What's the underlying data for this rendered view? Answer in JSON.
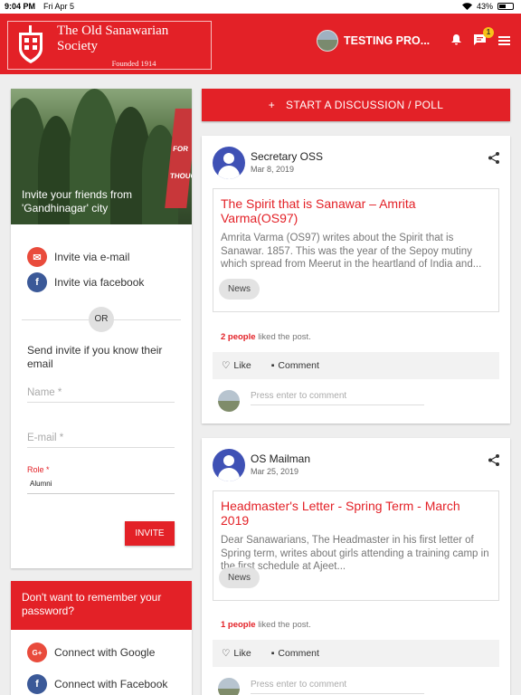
{
  "status_bar": {
    "time": "9:04 PM",
    "date": "Fri Apr 5",
    "battery": "43%"
  },
  "header": {
    "title": "The Old Sanawarian Society",
    "subtitle": "Founded 1914",
    "user_name": "TESTING PRO...",
    "chat_badge": "1",
    "icons": [
      "bell-icon",
      "chat-icon",
      "menu-icon"
    ]
  },
  "invite": {
    "hero_text": "Invite your friends from 'Gandhinagar' city",
    "via_email": "Invite via e-mail",
    "via_facebook": "Invite via facebook",
    "or": "OR",
    "send_text": "Send invite if you know their email",
    "name_placeholder": "Name *",
    "email_placeholder": "E-mail *",
    "role_label": "Role *",
    "role_value": "Alumni",
    "button": "INVITE"
  },
  "password_card": {
    "heading": "Don't want to remember your password?",
    "google": "Connect with Google",
    "facebook": "Connect with Facebook"
  },
  "start_discussion": {
    "label": "START A DISCUSSION / POLL"
  },
  "posts": [
    {
      "author": "Secretary OSS",
      "date": "Mar 8, 2019",
      "title": "The Spirit that is Sanawar – Amrita Varma(OS97)",
      "excerpt": "Amrita Varma (OS97) writes about the Spirit that is Sanawar. 1857. This was the year of the Sepoy mutiny which spread from Meerut in the heartland of India and...",
      "tag": "News",
      "likes_count": "2 people",
      "likes_text": "liked the post.",
      "like_label": "Like",
      "comment_label": "Comment",
      "comment_placeholder": "Press enter to comment"
    },
    {
      "author": "OS Mailman",
      "date": "Mar 25, 2019",
      "title": "Headmaster's Letter - Spring Term - March 2019",
      "excerpt": "Dear Sanawarians,   The Headmaster in his first letter of Spring term, writes about girls attending a training camp  in the first schedule at Ajeet...",
      "tag": "News",
      "likes_count": "1 people",
      "likes_text": "liked the post.",
      "like_label": "Like",
      "comment_label": "Comment",
      "comment_placeholder": "Press enter to comment"
    }
  ],
  "colors": {
    "brand_red": "#e32127",
    "avatar_blue": "#3f51b5",
    "badge_yellow": "#f7c21a"
  }
}
